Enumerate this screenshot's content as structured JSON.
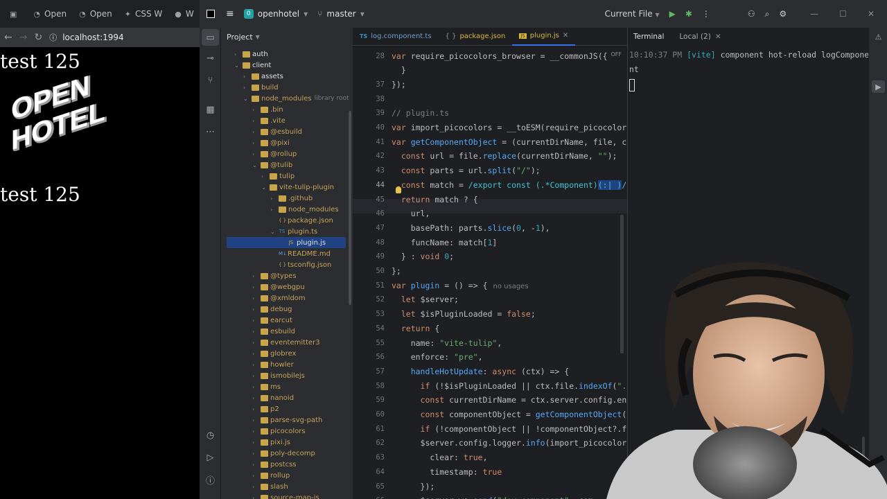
{
  "browser": {
    "tabs": [
      {
        "icon": "grid-icon",
        "label": ""
      },
      {
        "icon": "globe-icon",
        "label": "Open"
      },
      {
        "icon": "globe-icon",
        "label": "Open"
      },
      {
        "icon": "css-icon",
        "label": "CSS W"
      },
      {
        "icon": "github-icon",
        "label": "W"
      }
    ],
    "url": "localhost:1994",
    "page": {
      "text_top": "test 125",
      "text_bottom": "test 125",
      "logo_text": "OPEN HOTEL"
    }
  },
  "ide": {
    "project_name": "openhotel",
    "project_badge": "0",
    "branch": "master",
    "run_config": "Current File",
    "project_panel_title": "Project",
    "tree": [
      {
        "label": "auth",
        "depth": 1,
        "type": "folder",
        "open": false
      },
      {
        "label": "client",
        "depth": 1,
        "type": "folder",
        "open": true
      },
      {
        "label": "assets",
        "depth": 2,
        "type": "folder",
        "open": false
      },
      {
        "label": "build",
        "depth": 2,
        "type": "folder",
        "open": false,
        "excluded": true
      },
      {
        "label": "node_modules",
        "depth": 2,
        "type": "folder",
        "open": true,
        "excluded": true,
        "hint": "library root"
      },
      {
        "label": ".bin",
        "depth": 3,
        "type": "folder",
        "open": false,
        "excluded": true
      },
      {
        "label": ".vite",
        "depth": 3,
        "type": "folder",
        "open": false,
        "excluded": true
      },
      {
        "label": "@esbuild",
        "depth": 3,
        "type": "folder",
        "open": false,
        "excluded": true
      },
      {
        "label": "@pixi",
        "depth": 3,
        "type": "folder",
        "open": false,
        "excluded": true
      },
      {
        "label": "@rollup",
        "depth": 3,
        "type": "folder",
        "open": false,
        "excluded": true
      },
      {
        "label": "@tulib",
        "depth": 3,
        "type": "folder",
        "open": true,
        "excluded": true
      },
      {
        "label": "tulip",
        "depth": 4,
        "type": "folder",
        "open": false,
        "excluded": true
      },
      {
        "label": "vite-tulip-plugin",
        "depth": 4,
        "type": "folder",
        "open": true,
        "excluded": true
      },
      {
        "label": ".github",
        "depth": 5,
        "type": "folder",
        "open": false,
        "excluded": true
      },
      {
        "label": "node_modules",
        "depth": 5,
        "type": "folder",
        "open": false,
        "excluded": true
      },
      {
        "label": "package.json",
        "depth": 5,
        "type": "json",
        "excluded": true
      },
      {
        "label": "plugin.ts",
        "depth": 5,
        "type": "ts",
        "open": true,
        "excluded": true
      },
      {
        "label": "plugin.js",
        "depth": 6,
        "type": "js",
        "selected": true,
        "excluded": true
      },
      {
        "label": "README.md",
        "depth": 5,
        "type": "md",
        "excluded": true
      },
      {
        "label": "tsconfig.json",
        "depth": 5,
        "type": "json",
        "excluded": true
      },
      {
        "label": "@types",
        "depth": 3,
        "type": "folder",
        "open": false,
        "excluded": true
      },
      {
        "label": "@webgpu",
        "depth": 3,
        "type": "folder",
        "open": false,
        "excluded": true
      },
      {
        "label": "@xmldom",
        "depth": 3,
        "type": "folder",
        "open": false,
        "excluded": true
      },
      {
        "label": "debug",
        "depth": 3,
        "type": "folder",
        "open": false,
        "excluded": true
      },
      {
        "label": "earcut",
        "depth": 3,
        "type": "folder",
        "open": false,
        "excluded": true
      },
      {
        "label": "esbuild",
        "depth": 3,
        "type": "folder",
        "open": false,
        "excluded": true
      },
      {
        "label": "eventemitter3",
        "depth": 3,
        "type": "folder",
        "open": false,
        "excluded": true
      },
      {
        "label": "globrex",
        "depth": 3,
        "type": "folder",
        "open": false,
        "excluded": true
      },
      {
        "label": "howler",
        "depth": 3,
        "type": "folder",
        "open": false,
        "excluded": true
      },
      {
        "label": "ismobilejs",
        "depth": 3,
        "type": "folder",
        "open": false,
        "excluded": true
      },
      {
        "label": "ms",
        "depth": 3,
        "type": "folder",
        "open": false,
        "excluded": true
      },
      {
        "label": "nanoid",
        "depth": 3,
        "type": "folder",
        "open": false,
        "excluded": true
      },
      {
        "label": "p2",
        "depth": 3,
        "type": "folder",
        "open": false,
        "excluded": true
      },
      {
        "label": "parse-svg-path",
        "depth": 3,
        "type": "folder",
        "open": false,
        "excluded": true
      },
      {
        "label": "picocolors",
        "depth": 3,
        "type": "folder",
        "open": false,
        "excluded": true
      },
      {
        "label": "pixi.js",
        "depth": 3,
        "type": "folder",
        "open": false,
        "excluded": true
      },
      {
        "label": "poly-decomp",
        "depth": 3,
        "type": "folder",
        "open": false,
        "excluded": true
      },
      {
        "label": "postcss",
        "depth": 3,
        "type": "folder",
        "open": false,
        "excluded": true
      },
      {
        "label": "rollup",
        "depth": 3,
        "type": "folder",
        "open": false,
        "excluded": true
      },
      {
        "label": "slash",
        "depth": 3,
        "type": "folder",
        "open": false,
        "excluded": true
      },
      {
        "label": "source-map-js",
        "depth": 3,
        "type": "folder",
        "open": false,
        "excluded": true
      }
    ],
    "editor_tabs": [
      {
        "label": "log.component.ts",
        "type": "ts",
        "active": false
      },
      {
        "label": "package.json",
        "type": "json",
        "active": false
      },
      {
        "label": "plugin.js",
        "type": "js",
        "active": true
      }
    ],
    "off_badge": "OFF",
    "current_line": "44",
    "code_lines": [
      {
        "n": "28",
        "html": "<span class='kw'>var</span> require_picocolors_browser = __commonJS({"
      },
      {
        "n": "",
        "html": "  }"
      },
      {
        "n": "37",
        "html": "});"
      },
      {
        "n": "38",
        "html": ""
      },
      {
        "n": "39",
        "html": "<span class='cmt'>// plugin.ts</span>"
      },
      {
        "n": "40",
        "html": "<span class='kw'>var</span> import_picocolors = __toESM(require_picocolors_"
      },
      {
        "n": "41",
        "html": "<span class='kw'>var</span> <span class='fn'>getComponentObject</span> = (currentDirName, file, con"
      },
      {
        "n": "42",
        "html": "  <span class='kw'>const</span> url = file.<span class='fn'>replace</span>(currentDirName, <span class='str'>\"\"</span>);"
      },
      {
        "n": "43",
        "html": "  <span class='kw'>const</span> parts = url.<span class='fn'>split</span>(<span class='str'>\"/\"</span>);"
      },
      {
        "n": "44",
        "html": "  <span class='kw'>const</span> match = <span class='rx'>/export const (.*Component)</span><span class='sel rx'>(:| )</span><span class='rx'>/</span>.e"
      },
      {
        "n": "45",
        "html": "  <span class='kw'>return</span> match ? {"
      },
      {
        "n": "46",
        "html": "    url,"
      },
      {
        "n": "47",
        "html": "    basePath: parts.<span class='fn'>slice</span>(<span class='num'>0</span>, -<span class='num'>1</span>),"
      },
      {
        "n": "48",
        "html": "    funcName: match[<span class='num'>1</span>]"
      },
      {
        "n": "49",
        "html": "  } : <span class='kw'>void</span> <span class='num'>0</span>;"
      },
      {
        "n": "50",
        "html": "};"
      },
      {
        "n": "51",
        "html": "<span class='kw'>var</span> <span class='fn'>plugin</span> = () => {<span class='inlay'>no usages</span>"
      },
      {
        "n": "52",
        "html": "  <span class='kw'>let</span> $server;"
      },
      {
        "n": "53",
        "html": "  <span class='kw'>let</span> $isPluginLoaded = <span class='kw'>false</span>;"
      },
      {
        "n": "54",
        "html": "  <span class='kw'>return</span> {"
      },
      {
        "n": "55",
        "html": "    name: <span class='str'>\"vite-tulip\"</span>,"
      },
      {
        "n": "56",
        "html": "    enforce: <span class='str'>\"pre\"</span>,"
      },
      {
        "n": "57",
        "html": "    <span class='fn'>handleHotUpdate</span>: <span class='kw'>async</span> (ctx) => {"
      },
      {
        "n": "58",
        "html": "      <span class='kw'>if</span> (!$isPluginLoaded || ctx.file.<span class='fn'>indexOf</span>(<span class='str'>\".co</span>"
      },
      {
        "n": "59",
        "html": "      <span class='kw'>const</span> currentDirName = ctx.server.config.envD"
      },
      {
        "n": "60",
        "html": "      <span class='kw'>const</span> componentObject = <span class='fn'>getComponentObject</span>(cu"
      },
      {
        "n": "61",
        "html": "      <span class='kw'>if</span> (!componentObject || !componentObject?.fun"
      },
      {
        "n": "62",
        "html": "      $server.config.logger.<span class='fn'>info</span>(import_picocolors."
      },
      {
        "n": "63",
        "html": "        clear: <span class='kw'>true</span>,"
      },
      {
        "n": "64",
        "html": "        timestamp: <span class='kw'>true</span>"
      },
      {
        "n": "65",
        "html": "      });"
      },
      {
        "n": "66",
        "html": "      $server.ws.<span class='fn'>send</span>(<span class='str'>\"dev:component\"</span>, com"
      }
    ],
    "terminal": {
      "tab_title": "Terminal",
      "tab_local": "Local (2)",
      "line1_time": "10:10:37 PM",
      "line1_tag": "[vite]",
      "line1_msg": "component hot-reload logCompone",
      "line2": "nt"
    }
  },
  "colors": {
    "accent": "#3574f0",
    "selection": "#214283",
    "keyword": "#cf8e6d",
    "string": "#6aab73",
    "folder": "#c9a54a"
  }
}
